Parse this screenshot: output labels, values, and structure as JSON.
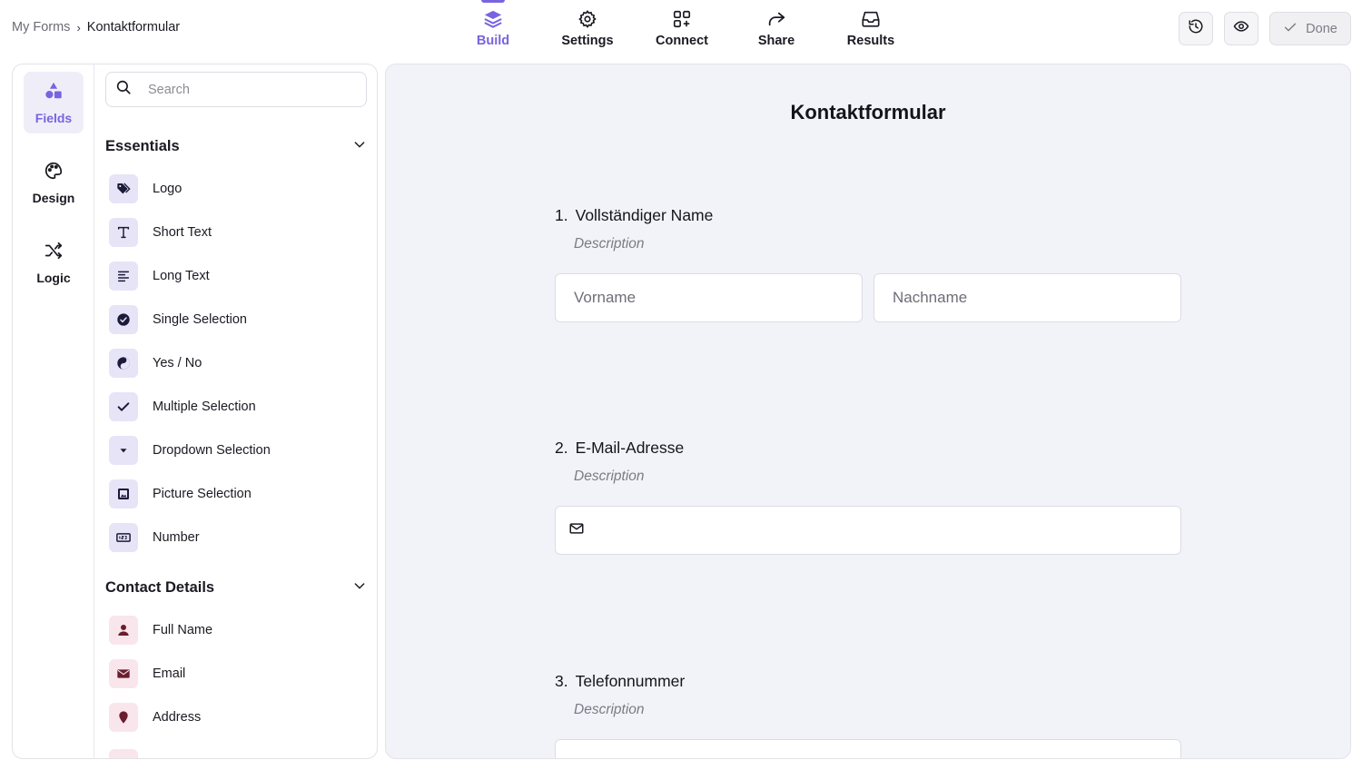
{
  "breadcrumb": {
    "root": "My Forms",
    "separator": "›",
    "current": "Kontaktformular"
  },
  "top_tabs": [
    {
      "label": "Build",
      "icon": "layers-icon",
      "active": true
    },
    {
      "label": "Settings",
      "icon": "gear-icon",
      "active": false
    },
    {
      "label": "Connect",
      "icon": "apps-plus-icon",
      "active": false
    },
    {
      "label": "Share",
      "icon": "share-arrow-icon",
      "active": false
    },
    {
      "label": "Results",
      "icon": "inbox-icon",
      "active": false
    }
  ],
  "actions": {
    "history_icon": "history-icon",
    "preview_icon": "eye-icon",
    "done_label": "Done"
  },
  "rail": [
    {
      "label": "Fields",
      "icon": "shapes-icon",
      "active": true
    },
    {
      "label": "Design",
      "icon": "palette-icon",
      "active": false
    },
    {
      "label": "Logic",
      "icon": "shuffle-icon",
      "active": false
    }
  ],
  "search": {
    "placeholder": "Search",
    "value": ""
  },
  "sections": {
    "essentials": {
      "title": "Essentials",
      "items": [
        {
          "label": "Logo",
          "icon": "tag-icon"
        },
        {
          "label": "Short Text",
          "icon": "text-t-icon"
        },
        {
          "label": "Long Text",
          "icon": "align-left-icon"
        },
        {
          "label": "Single Selection",
          "icon": "check-circle-icon"
        },
        {
          "label": "Yes / No",
          "icon": "yin-yang-icon"
        },
        {
          "label": "Multiple Selection",
          "icon": "check-icon"
        },
        {
          "label": "Dropdown Selection",
          "icon": "caret-down-icon"
        },
        {
          "label": "Picture Selection",
          "icon": "image-icon"
        },
        {
          "label": "Number",
          "icon": "number-icon"
        }
      ]
    },
    "contact": {
      "title": "Contact Details",
      "items": [
        {
          "label": "Full Name",
          "icon": "person-icon"
        },
        {
          "label": "Email",
          "icon": "envelope-icon"
        },
        {
          "label": "Address",
          "icon": "map-pin-icon"
        }
      ]
    }
  },
  "form": {
    "title": "Kontaktformular",
    "questions": [
      {
        "number": "1.",
        "title": "Vollständiger Name",
        "description": "Description",
        "first_placeholder": "Vorname",
        "last_placeholder": "Nachname"
      },
      {
        "number": "2.",
        "title": "E-Mail-Adresse",
        "description": "Description"
      },
      {
        "number": "3.",
        "title": "Telefonnummer",
        "description": "Description"
      }
    ]
  },
  "colors": {
    "accent": "#7a63e0",
    "canvas_bg": "#f2f3f9",
    "field_icon_bg": "#e7e4f7",
    "contact_icon_bg": "#f9e6ec",
    "contact_icon_fg": "#6b1d2e"
  }
}
